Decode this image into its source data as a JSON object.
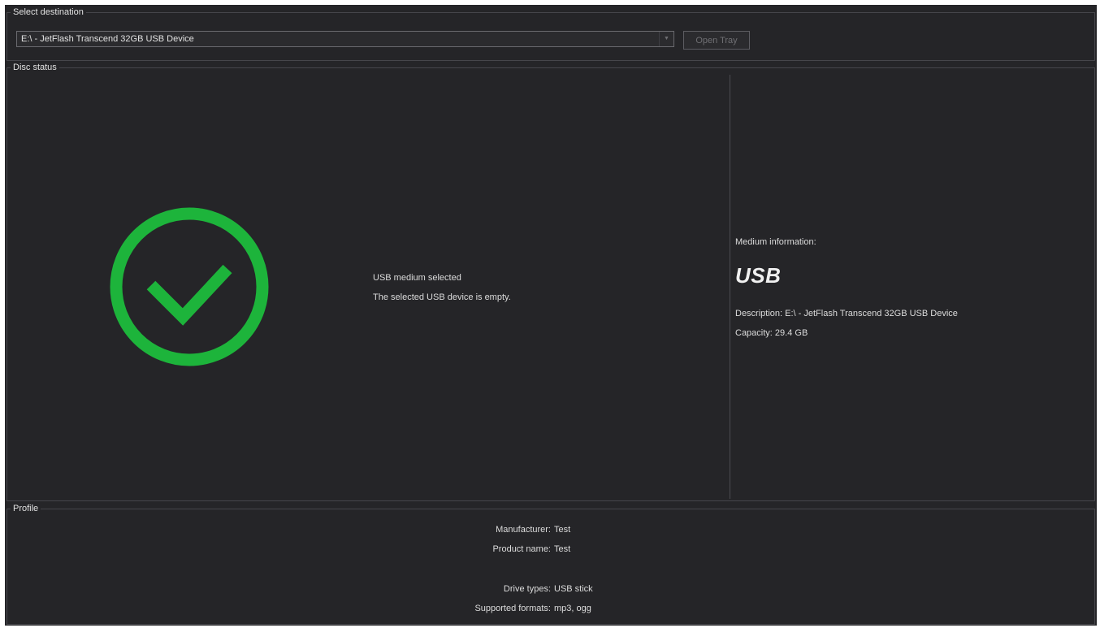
{
  "destination": {
    "group_title": "Select destination",
    "selected_drive": "E:\\ - JetFlash Transcend 32GB USB Device",
    "open_tray_label": "Open Tray"
  },
  "disc_status": {
    "group_title": "Disc status",
    "status_icon": "check-circle-icon",
    "status_color": "#1db43b",
    "status_title": "USB medium selected",
    "status_description": "The selected USB device is empty.",
    "medium_info_label": "Medium information:",
    "medium_type": "USB",
    "description_label": "Description:",
    "description_value": "E:\\ - JetFlash Transcend 32GB USB Device",
    "capacity_label": "Capacity:",
    "capacity_value": "29.4 GB"
  },
  "profile": {
    "group_title": "Profile",
    "manufacturer_label": "Manufacturer:",
    "manufacturer_value": "Test",
    "product_name_label": "Product name:",
    "product_name_value": "Test",
    "drive_types_label": "Drive types:",
    "drive_types_value": "USB stick",
    "supported_formats_label": "Supported formats:",
    "supported_formats_value": "mp3, ogg"
  }
}
